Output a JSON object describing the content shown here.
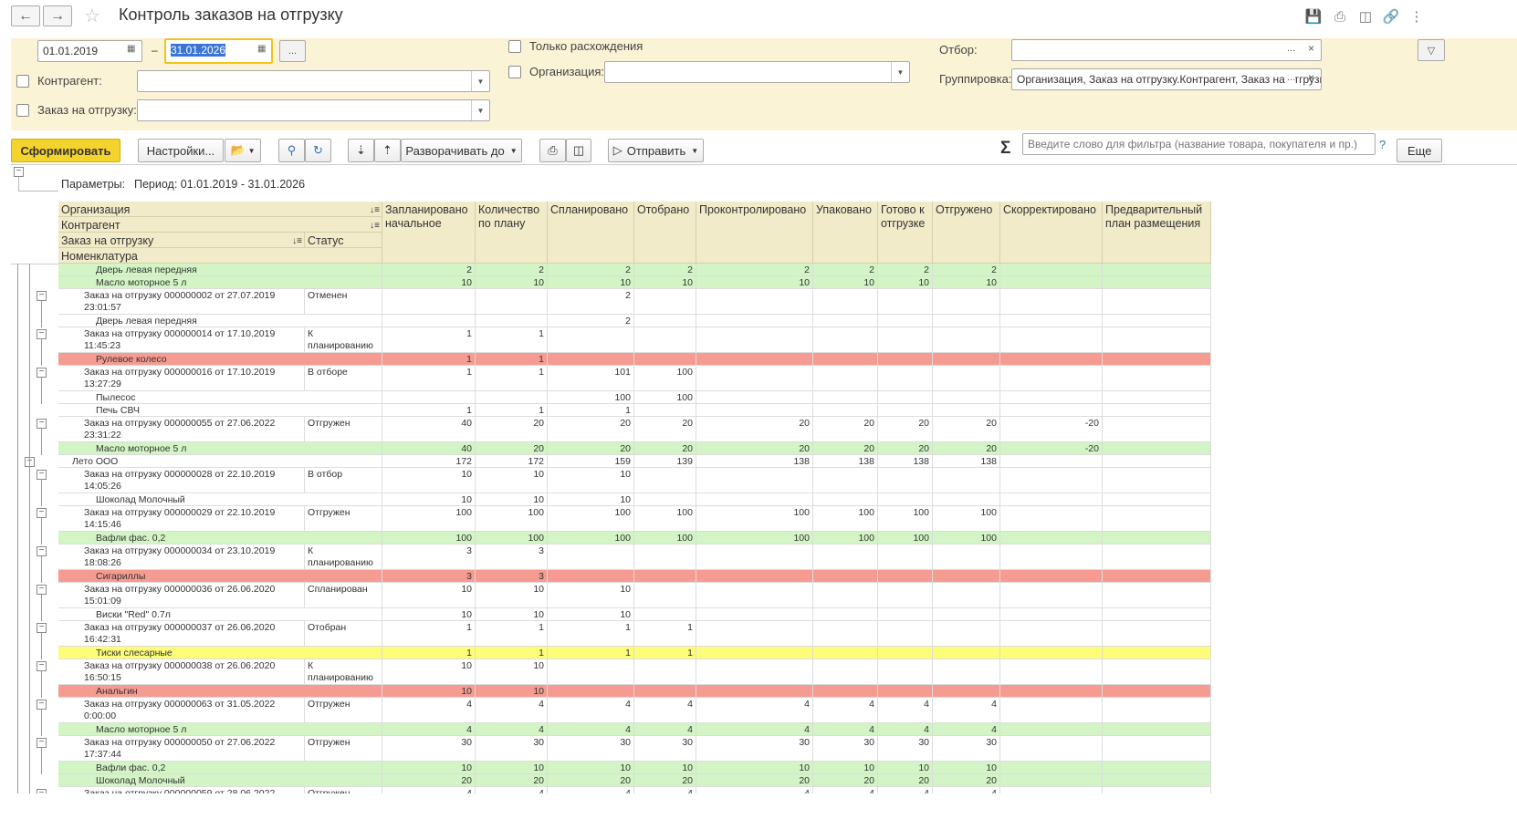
{
  "window": {
    "title": "Контроль заказов на отгрузку"
  },
  "filters": {
    "date_from": "01.01.2019",
    "dash": "–",
    "date_to": "31.01.2026",
    "dots": "...",
    "contractor_label": "Контрагент:",
    "order_label": "Заказ на отгрузку:",
    "only_diff_label": "Только расхождения",
    "organization_label": "Организация:",
    "selection_label": "Отбор:",
    "grouping_label": "Группировка:",
    "grouping_value": "Организация, Заказ на отгрузку.Контрагент, Заказ на отгрузку"
  },
  "toolbar": {
    "generate": "Сформировать",
    "settings": "Настройки...",
    "expand_to": "Разворачивать до",
    "send": "Отправить",
    "sigma": "Σ",
    "search_placeholder": "Введите слово для фильтра (название товара, покупателя и пр.)",
    "help": "?",
    "more": "Еще"
  },
  "report": {
    "params_label": "Параметры:",
    "period": "Период: 01.01.2019 - 31.01.2026",
    "group_headers": {
      "organization": "Организация",
      "contractor": "Контрагент",
      "order": "Заказ на отгрузку",
      "status": "Статус",
      "nomenclature": "Номенклатура"
    },
    "columns": [
      "Запланировано начальное",
      "Количество по плану",
      "Спланировано",
      "Отобрано",
      "Проконтролировано",
      "Упаковано",
      "Готово к отгрузке",
      "Отгружено",
      "Скорректировано",
      "Предварительный план размещения"
    ],
    "rows": [
      {
        "t": "i",
        "bg": "g",
        "n": "Дверь левая передняя",
        "s": "",
        "v": [
          "2",
          "2",
          "2",
          "2",
          "2",
          "2",
          "2",
          "2",
          "",
          ""
        ]
      },
      {
        "t": "i",
        "bg": "g",
        "n": "Масло моторное 5 л",
        "s": "",
        "v": [
          "10",
          "10",
          "10",
          "10",
          "10",
          "10",
          "10",
          "10",
          "",
          ""
        ]
      },
      {
        "t": "o",
        "bg": "w",
        "n": "Заказ на отгрузку 000000002 от 27.07.2019",
        "n2": "23:01:57",
        "s": "Отменен",
        "v": [
          "",
          "",
          "2",
          "",
          "",
          "",
          "",
          "",
          "",
          ""
        ]
      },
      {
        "t": "i",
        "bg": "w",
        "n": "Дверь левая передняя",
        "s": "",
        "v": [
          "",
          "",
          "2",
          "",
          "",
          "",
          "",
          "",
          "",
          ""
        ]
      },
      {
        "t": "o",
        "bg": "w",
        "n": "Заказ на отгрузку 000000014 от 17.10.2019",
        "n2": "11:45:23",
        "s": "К планированию",
        "v": [
          "1",
          "1",
          "",
          "",
          "",
          "",
          "",
          "",
          "",
          ""
        ]
      },
      {
        "t": "i",
        "bg": "r",
        "n": "Рулевое колесо",
        "s": "",
        "v": [
          "1",
          "1",
          "",
          "",
          "",
          "",
          "",
          "",
          "",
          ""
        ]
      },
      {
        "t": "o",
        "bg": "w",
        "n": "Заказ на отгрузку 000000016 от 17.10.2019",
        "n2": "13:27:29",
        "s": "В отборе",
        "v": [
          "1",
          "1",
          "101",
          "100",
          "",
          "",
          "",
          "",
          "",
          ""
        ]
      },
      {
        "t": "i",
        "bg": "w",
        "n": "Пылесос",
        "s": "",
        "v": [
          "",
          "",
          "100",
          "100",
          "",
          "",
          "",
          "",
          "",
          ""
        ]
      },
      {
        "t": "i",
        "bg": "w",
        "n": "Печь СВЧ",
        "s": "",
        "v": [
          "1",
          "1",
          "1",
          "",
          "",
          "",
          "",
          "",
          "",
          ""
        ]
      },
      {
        "t": "o",
        "bg": "w",
        "n": "Заказ на отгрузку 000000055 от 27.06.2022",
        "n2": "23:31:22",
        "s": "Отгружен",
        "v": [
          "40",
          "20",
          "20",
          "20",
          "20",
          "20",
          "20",
          "20",
          "-20",
          ""
        ]
      },
      {
        "t": "i",
        "bg": "g",
        "n": "Масло моторное 5 л",
        "s": "",
        "v": [
          "40",
          "20",
          "20",
          "20",
          "20",
          "20",
          "20",
          "20",
          "-20",
          ""
        ]
      },
      {
        "t": "c",
        "bg": "w",
        "n": "Лето ООО",
        "s": "",
        "v": [
          "172",
          "172",
          "159",
          "139",
          "138",
          "138",
          "138",
          "138",
          "",
          ""
        ]
      },
      {
        "t": "o",
        "bg": "w",
        "n": "Заказ на отгрузку 000000028 от 22.10.2019",
        "n2": "14:05:26",
        "s": "В отбор",
        "v": [
          "10",
          "10",
          "10",
          "",
          "",
          "",
          "",
          "",
          "",
          ""
        ]
      },
      {
        "t": "i",
        "bg": "w",
        "n": "Шоколад Молочный",
        "s": "",
        "v": [
          "10",
          "10",
          "10",
          "",
          "",
          "",
          "",
          "",
          "",
          ""
        ]
      },
      {
        "t": "o",
        "bg": "w",
        "n": "Заказ на отгрузку 000000029 от 22.10.2019",
        "n2": "14:15:46",
        "s": "Отгружен",
        "v": [
          "100",
          "100",
          "100",
          "100",
          "100",
          "100",
          "100",
          "100",
          "",
          ""
        ]
      },
      {
        "t": "i",
        "bg": "g",
        "n": "Вафли фас. 0,2",
        "s": "",
        "v": [
          "100",
          "100",
          "100",
          "100",
          "100",
          "100",
          "100",
          "100",
          "",
          ""
        ]
      },
      {
        "t": "o",
        "bg": "w",
        "n": "Заказ на отгрузку 000000034 от 23.10.2019",
        "n2": "18:08:26",
        "s": "К планированию",
        "v": [
          "3",
          "3",
          "",
          "",
          "",
          "",
          "",
          "",
          "",
          ""
        ]
      },
      {
        "t": "i",
        "bg": "r",
        "n": "Сигариллы",
        "s": "",
        "v": [
          "3",
          "3",
          "",
          "",
          "",
          "",
          "",
          "",
          "",
          ""
        ]
      },
      {
        "t": "o",
        "bg": "w",
        "n": "Заказ на отгрузку 000000036 от 26.06.2020",
        "n2": "15:01:09",
        "s": "Спланирован",
        "v": [
          "10",
          "10",
          "10",
          "",
          "",
          "",
          "",
          "",
          "",
          ""
        ]
      },
      {
        "t": "i",
        "bg": "w",
        "n": "Виски \"Red\" 0.7л",
        "s": "",
        "v": [
          "10",
          "10",
          "10",
          "",
          "",
          "",
          "",
          "",
          "",
          ""
        ]
      },
      {
        "t": "o",
        "bg": "w",
        "n": "Заказ на отгрузку 000000037 от 26.06.2020",
        "n2": "16:42:31",
        "s": "Отобран",
        "v": [
          "1",
          "1",
          "1",
          "1",
          "",
          "",
          "",
          "",
          "",
          ""
        ]
      },
      {
        "t": "i",
        "bg": "y",
        "n": "Тиски слесарные",
        "s": "",
        "v": [
          "1",
          "1",
          "1",
          "1",
          "",
          "",
          "",
          "",
          "",
          ""
        ]
      },
      {
        "t": "o",
        "bg": "w",
        "n": "Заказ на отгрузку 000000038 от 26.06.2020",
        "n2": "16:50:15",
        "s": "К планированию",
        "v": [
          "10",
          "10",
          "",
          "",
          "",
          "",
          "",
          "",
          "",
          ""
        ]
      },
      {
        "t": "i",
        "bg": "r",
        "n": "Анальгин",
        "s": "",
        "v": [
          "10",
          "10",
          "",
          "",
          "",
          "",
          "",
          "",
          "",
          ""
        ]
      },
      {
        "t": "o",
        "bg": "w",
        "n": "Заказ на отгрузку 000000063 от 31.05.2022",
        "n2": "0:00:00",
        "s": "Отгружен",
        "v": [
          "4",
          "4",
          "4",
          "4",
          "4",
          "4",
          "4",
          "4",
          "",
          ""
        ]
      },
      {
        "t": "i",
        "bg": "g",
        "n": "Масло моторное 5 л",
        "s": "",
        "v": [
          "4",
          "4",
          "4",
          "4",
          "4",
          "4",
          "4",
          "4",
          "",
          ""
        ]
      },
      {
        "t": "o",
        "bg": "w",
        "n": "Заказ на отгрузку 000000050 от 27.06.2022",
        "n2": "17:37:44",
        "s": "Отгружен",
        "v": [
          "30",
          "30",
          "30",
          "30",
          "30",
          "30",
          "30",
          "30",
          "",
          ""
        ]
      },
      {
        "t": "i",
        "bg": "g",
        "n": "Вафли фас. 0,2",
        "s": "",
        "v": [
          "10",
          "10",
          "10",
          "10",
          "10",
          "10",
          "10",
          "10",
          "",
          ""
        ]
      },
      {
        "t": "i",
        "bg": "g",
        "n": "Шоколад Молочный",
        "s": "",
        "v": [
          "20",
          "20",
          "20",
          "20",
          "20",
          "20",
          "20",
          "20",
          "",
          ""
        ]
      },
      {
        "t": "o",
        "bg": "w",
        "n": "Заказ на отгрузку 000000059 от 28.06.2022",
        "n2": "",
        "s": "Отгружен",
        "v": [
          "4",
          "4",
          "4",
          "4",
          "4",
          "4",
          "4",
          "4",
          "",
          ""
        ]
      }
    ]
  },
  "colors": {
    "g": "#d3f5c5",
    "r": "#f59b91",
    "y": "#fdfd7a",
    "w": "#ffffff",
    "accent": "#f5d32d",
    "panel": "#fbf3d5"
  }
}
